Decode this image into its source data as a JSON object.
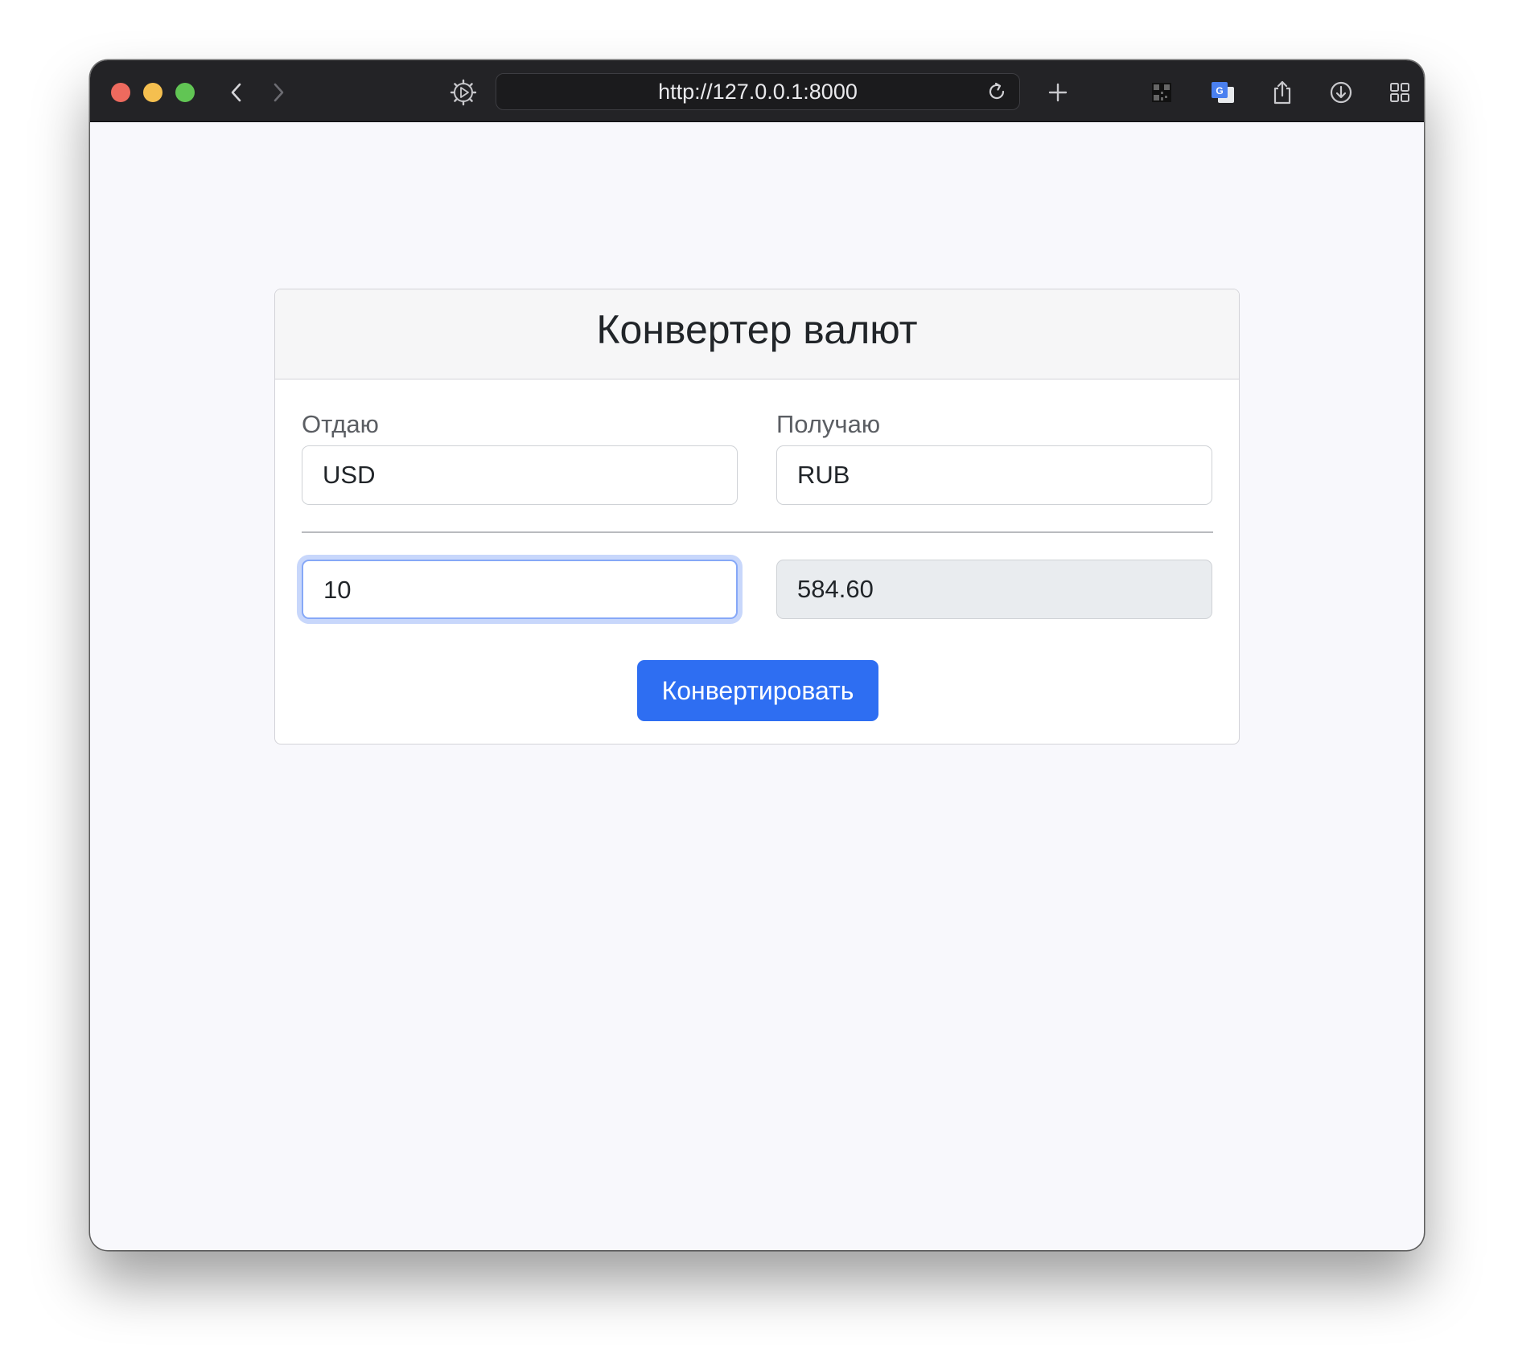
{
  "browser": {
    "url": "http://127.0.0.1:8000",
    "toolbar_icons": [
      "chevron-left-icon",
      "chevron-right-icon",
      "privacy-gear-icon",
      "reload-icon",
      "plus-icon",
      "qr-code-icon",
      "translate-icon",
      "share-icon",
      "download-icon",
      "tab-overview-icon"
    ]
  },
  "converter": {
    "title": "Конвертер валют",
    "from_label": "Отдаю",
    "to_label": "Получаю",
    "from_currency": "USD",
    "to_currency": "RUB",
    "amount": "10",
    "result": "584.60",
    "convert_label": "Конвертировать"
  },
  "colors": {
    "button": "#2e6ef2",
    "focus_ring": "#c8d7fb",
    "page_background": "#f8f8fc",
    "toolbar": "#232326"
  }
}
